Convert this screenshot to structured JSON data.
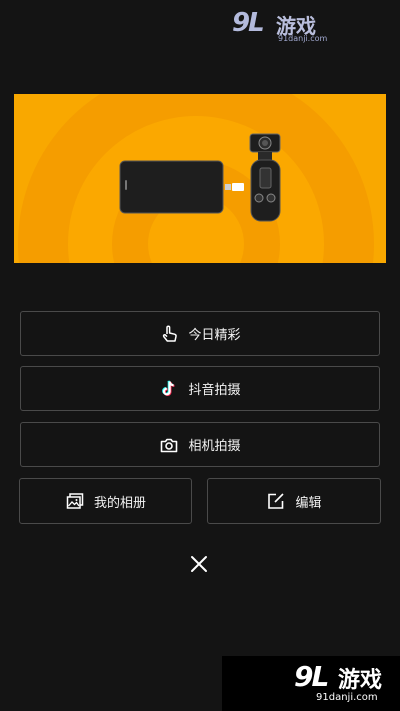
{
  "watermark": {
    "logo": "9L",
    "name": "游戏",
    "url": "91danji.com"
  },
  "banner": {
    "icon": "phone-to-gimbal-camera-illustration"
  },
  "menu": {
    "today_highlights": {
      "label": "今日精彩",
      "icon": "tap-hand-icon"
    },
    "douyin_shoot": {
      "label": "抖音拍摄",
      "icon": "tiktok-icon"
    },
    "camera_shoot": {
      "label": "相机拍摄",
      "icon": "camera-icon"
    },
    "my_album": {
      "label": "我的相册",
      "icon": "gallery-icon"
    },
    "edit": {
      "label": "编辑",
      "icon": "edit-icon"
    }
  },
  "close": {
    "icon": "close-icon"
  },
  "colors": {
    "background": "#141414",
    "banner": "#f39a00",
    "border": "#4a4a4a"
  }
}
